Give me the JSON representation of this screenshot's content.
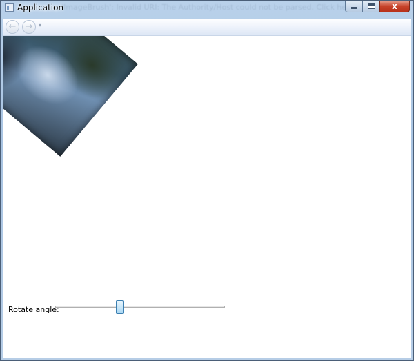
{
  "window": {
    "title": "Application",
    "title_ghost": "'ImageBrush': Invalid URI: The Authority/Host could not be parsed. Click here for details",
    "min_glyph": "_",
    "max_glyph": "□",
    "close_glyph": "x"
  },
  "nav": {
    "back_glyph": "←",
    "forward_glyph": "→",
    "dropdown_glyph": "▾"
  },
  "content": {
    "image_icon": "rotated-photo",
    "slider": {
      "label": "Rotate angle:",
      "value_fraction": 0.38
    }
  }
}
